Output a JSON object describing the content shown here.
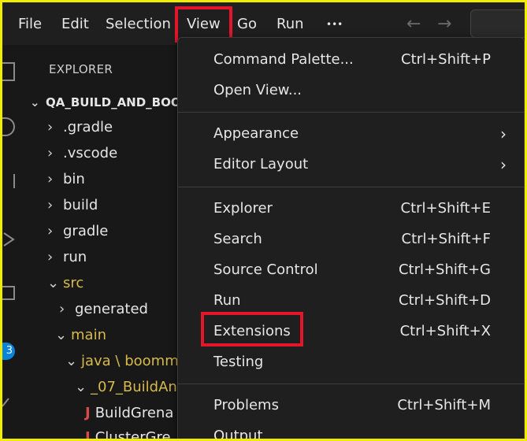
{
  "menubar": {
    "items": [
      "File",
      "Edit",
      "Selection",
      "View",
      "Go",
      "Run",
      "•••"
    ],
    "back_arrow": "←",
    "forward_arrow": "→"
  },
  "activity": {
    "badge_count": "3"
  },
  "explorer": {
    "title": "EXPLORER",
    "root": "QA_BUILD_AND_BOO",
    "rows": [
      {
        "chev": "›",
        "label": ".gradle"
      },
      {
        "chev": "›",
        "label": ".vscode"
      },
      {
        "chev": "›",
        "label": "bin"
      },
      {
        "chev": "›",
        "label": "build"
      },
      {
        "chev": "›",
        "label": "gradle"
      },
      {
        "chev": "›",
        "label": "run"
      },
      {
        "chev": "⌄",
        "label": "src"
      },
      {
        "chev": "›",
        "label": "generated"
      },
      {
        "chev": "⌄",
        "label": "main"
      },
      {
        "chev": "⌄",
        "label": "java \\ boomm"
      },
      {
        "chev": "⌄",
        "label": "_07_BuildAn"
      },
      {
        "chev": "J",
        "label": "BuildGrena"
      },
      {
        "chev": "J",
        "label": "ClusterGre"
      }
    ]
  },
  "view_menu": {
    "items": [
      {
        "label": "Command Palette...",
        "shortcut": "Ctrl+Shift+P"
      },
      {
        "label": "Open View...",
        "shortcut": ""
      },
      {
        "label": "Appearance",
        "shortcut": "",
        "submenu": "›"
      },
      {
        "label": "Editor Layout",
        "shortcut": "",
        "submenu": "›"
      },
      {
        "label": "Explorer",
        "shortcut": "Ctrl+Shift+E"
      },
      {
        "label": "Search",
        "shortcut": "Ctrl+Shift+F"
      },
      {
        "label": "Source Control",
        "shortcut": "Ctrl+Shift+G"
      },
      {
        "label": "Run",
        "shortcut": "Ctrl+Shift+D"
      },
      {
        "label": "Extensions",
        "shortcut": "Ctrl+Shift+X"
      },
      {
        "label": "Testing",
        "shortcut": ""
      },
      {
        "label": "Problems",
        "shortcut": "Ctrl+Shift+M"
      },
      {
        "label": "Output",
        "shortcut": ""
      }
    ]
  },
  "colors": {
    "highlight": "#e3152b",
    "background": "#1f1f1f",
    "folder_open": "#d7ba4a",
    "badge": "#0a84d8"
  }
}
